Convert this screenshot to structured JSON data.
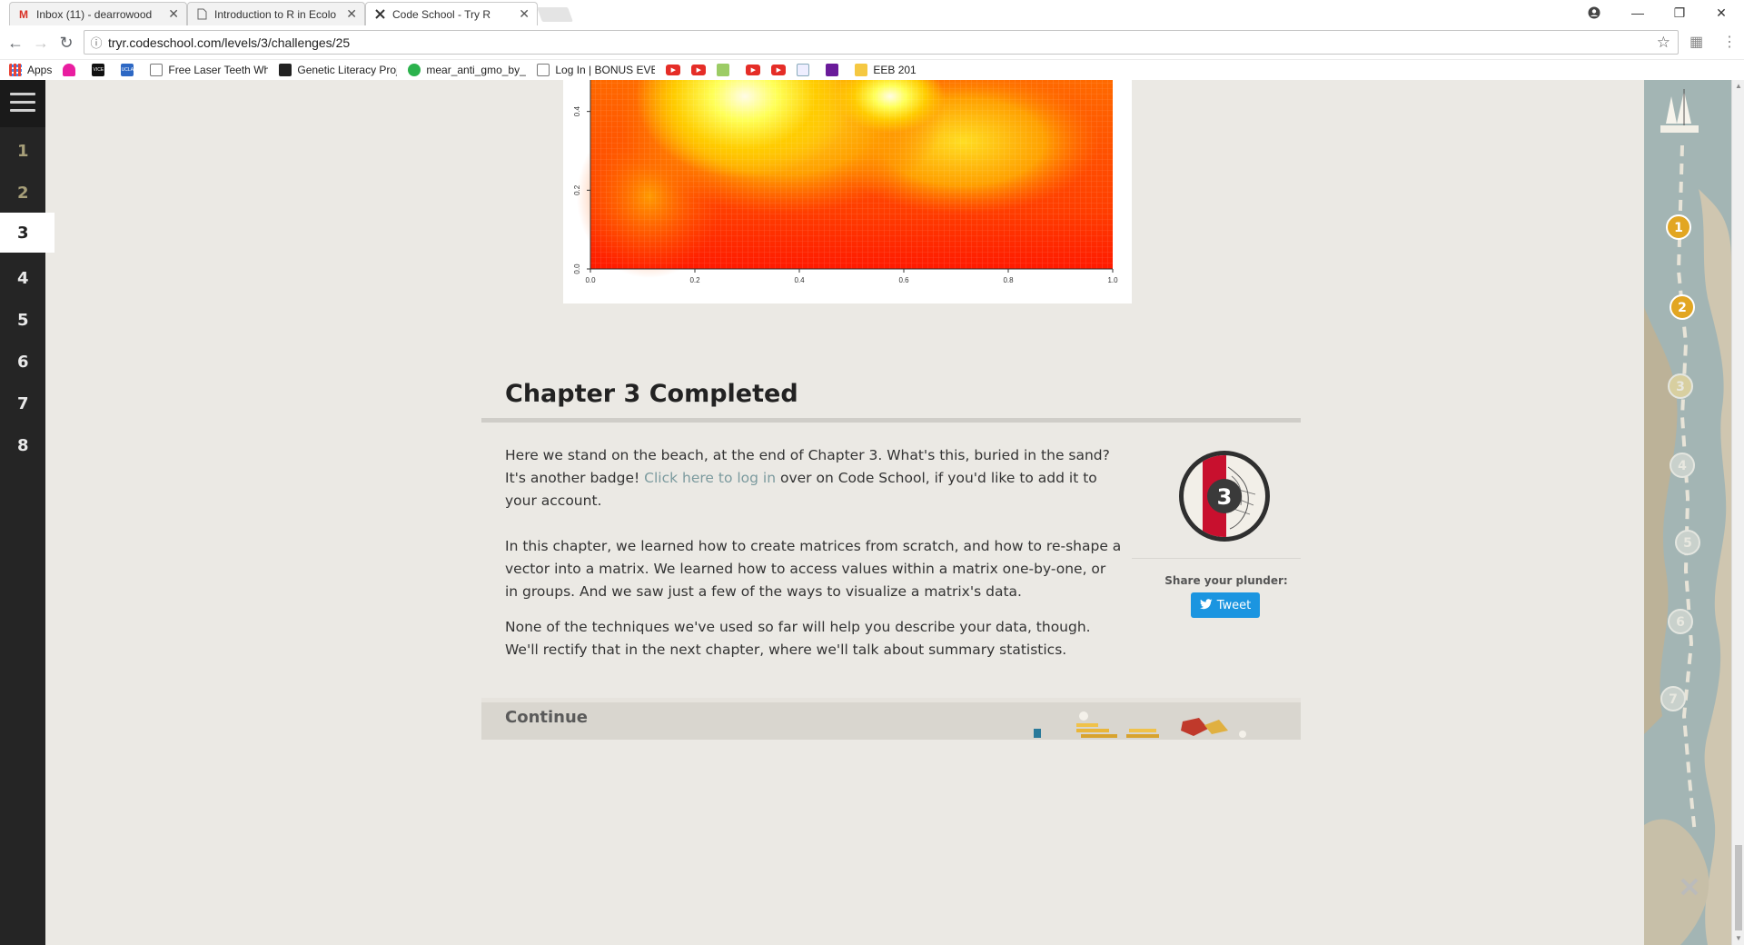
{
  "browser": {
    "tabs": [
      {
        "title": "Inbox (11) - dearrowood",
        "icon": "gmail-icon"
      },
      {
        "title": "Introduction to R in Ecolo",
        "icon": "document-icon"
      },
      {
        "title": "Code School - Try R",
        "icon": "codeschool-icon",
        "active": true
      }
    ],
    "url": "tryr.codeschool.com/levels/3/challenges/25",
    "bookmarks": [
      {
        "label": "Apps"
      },
      {
        "label": ""
      },
      {
        "label": "VICE"
      },
      {
        "label": "UCLA"
      },
      {
        "label": "Free Laser Teeth Whi"
      },
      {
        "label": "Genetic Literacy Proje"
      },
      {
        "label": "mear_anti_gmo_by_c"
      },
      {
        "label": "Log In | BONUS EVEN"
      },
      {
        "label": "EEB 201"
      }
    ]
  },
  "sidebar": {
    "levels": [
      "1",
      "2",
      "3",
      "4",
      "5",
      "6",
      "7",
      "8"
    ],
    "active_level": "3"
  },
  "chart_data": {
    "type": "heatmap",
    "xticks": [
      "0.0",
      "0.2",
      "0.4",
      "0.6",
      "0.8",
      "1.0"
    ],
    "yticks": [
      "0.0",
      "0.2",
      "0.4"
    ],
    "colormap": [
      "#ff1a00",
      "#ff7a00",
      "#ffcc00",
      "#ffff66",
      "#fffbe0"
    ]
  },
  "chapter": {
    "title": "Chapter 3 Completed",
    "p1_before": "Here we stand on the beach, at the end of Chapter 3. What's this, buried in the sand? It's another badge! ",
    "p1_link": "Click here to log in",
    "p1_after": " over on Code School, if you'd like to add it to your account.",
    "p2": "In this chapter, we learned how to create matrices from scratch, and how to re-shape a vector into a matrix. We learned how to access values within a matrix one-by-one, or in groups. And we saw just a few of the ways to visualize a matrix's data.",
    "p3": "None of the techniques we've used so far will help you describe your data, though. We'll rectify that in the next chapter, where we'll talk about summary statistics.",
    "badge_number": "3",
    "share_label": "Share your plunder:",
    "tweet_label": "Tweet",
    "continue_label": "Continue"
  },
  "map": {
    "markers": [
      "1",
      "2",
      "3",
      "4",
      "5",
      "6",
      "7"
    ]
  }
}
